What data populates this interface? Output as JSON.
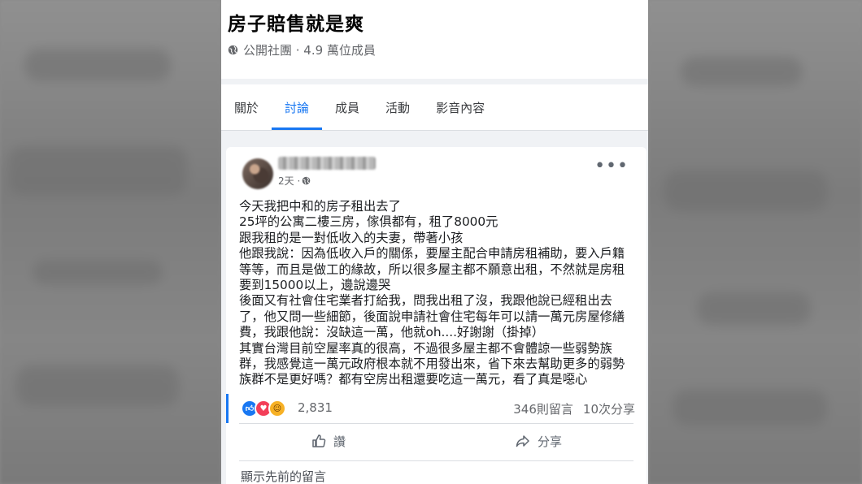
{
  "group": {
    "name": "房子賠售就是爽",
    "meta": "公開社團 · 4.9 萬位成員",
    "globe_icon": "globe-icon"
  },
  "tabs": [
    {
      "label": "關於"
    },
    {
      "label": "討論"
    },
    {
      "label": "成員"
    },
    {
      "label": "活動"
    },
    {
      "label": "影音內容"
    }
  ],
  "active_tab": "討論",
  "post": {
    "timestamp": "2天 ·",
    "more_icon": "more-dots-icon",
    "body_lines": [
      "今天我把中和的房子租出去了",
      "25坪的公寓二樓三房，傢俱都有，租了8000元",
      "跟我租的是一對低收入的夫妻，帶著小孩",
      "他跟我說：因為低收入戶的關係，要屋主配合申請房租補助，要入戶籍",
      "等等，而且是做工的緣故，所以很多屋主都不願意出租，不然就是房租",
      "要到15000以上，邊說邊哭",
      "後面又有社會住宅業者打給我，問我出租了沒，我跟他說已經租出去",
      "了，他又問一些細節，後面說申請社會住宅每年可以請一萬元房屋修繕",
      "費，我跟他說：沒缺這一萬，他就oh....好謝謝（掛掉）",
      "其實台灣目前空屋率真的很高，不過很多屋主都不會體諒一些弱勢族",
      "群，我感覺這一萬元政府根本就不用發出來，省下來去幫助更多的弱勢",
      "族群不是更好嗎？都有空房出租還要吃這一萬元，看了真是噁心"
    ],
    "reaction_count": "2,831",
    "comments": "346則留言",
    "shares": "10次分享",
    "like_label": "讚",
    "share_label": "分享",
    "show_previous": "顯示先前的留言"
  },
  "colors": {
    "accent": "#1877f2",
    "love": "#f33e58",
    "haha": "#f7b125"
  }
}
